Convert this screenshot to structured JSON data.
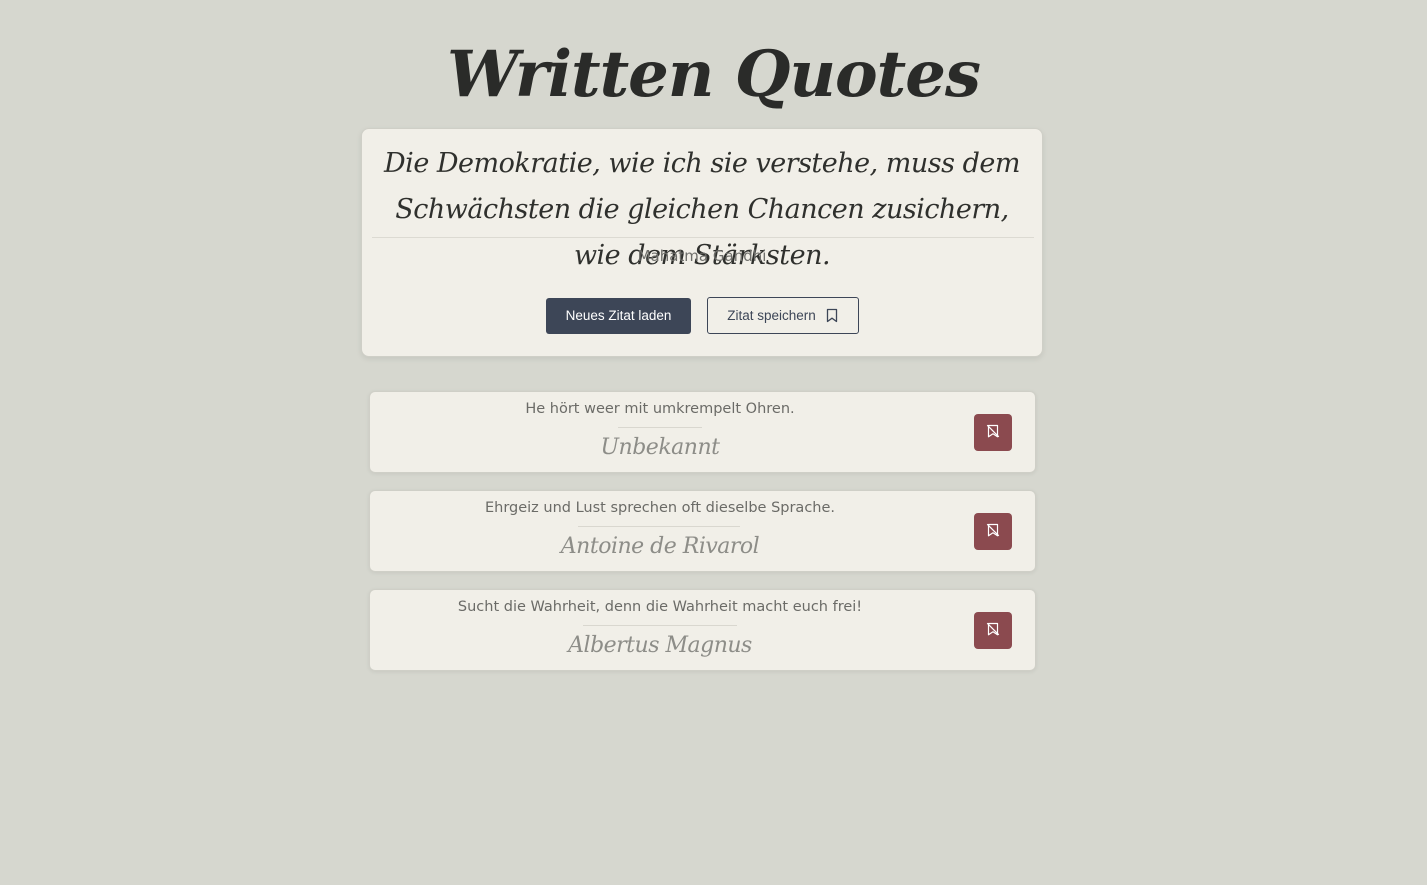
{
  "app": {
    "title": "Written Quotes"
  },
  "current_quote": {
    "text": "Die Demokratie, wie ich sie verstehe, muss dem Schwächsten die gleichen Chancen zusichern, wie dem Stärksten.",
    "author": "Mahatma Gandhi"
  },
  "buttons": {
    "load_label": "Neues Zitat laden",
    "save_label": "Zitat speichern",
    "save_icon": "bookmark-icon",
    "unsave_icon": "bookmark-off-icon"
  },
  "saved_quotes": [
    {
      "text": "He hört weer mit umkrempelt Ohren.",
      "author": "Unbekannt"
    },
    {
      "text": "Ehrgeiz und Lust sprechen oft dieselbe Sprache.",
      "author": "Antoine de Rivarol"
    },
    {
      "text": "Sucht die Wahrheit, denn die Wahrheit macht euch frei!",
      "author": "Albertus Magnus"
    }
  ],
  "colors": {
    "background": "#d6d7cf",
    "card": "#f1efe8",
    "primary": "#3d4657",
    "danger": "#8b4a4f"
  }
}
